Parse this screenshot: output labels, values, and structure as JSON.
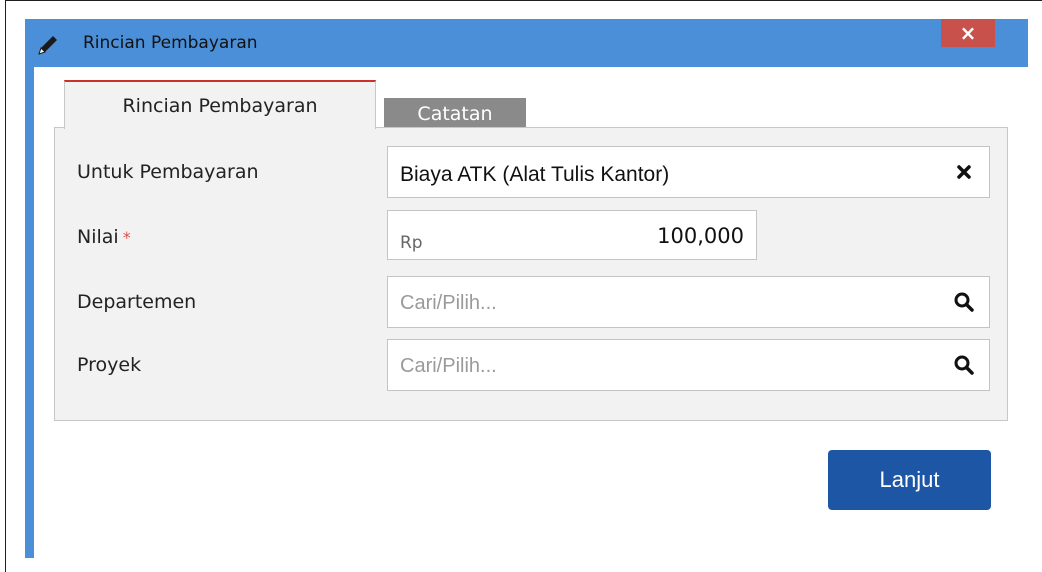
{
  "window": {
    "title": "Rincian Pembayaran",
    "close_glyph": "×",
    "icons": {
      "title": "pencil-icon",
      "close": "close-icon"
    }
  },
  "tabs": [
    {
      "label": "Rincian Pembayaran",
      "active": true
    },
    {
      "label": "Catatan",
      "active": false
    }
  ],
  "form": {
    "untuk_pembayaran": {
      "label": "Untuk Pembayaran",
      "value": "Biaya ATK (Alat Tulis Kantor)",
      "clear_icon": "clear-icon"
    },
    "nilai": {
      "label": "Nilai",
      "required_mark": "*",
      "prefix": "Rp",
      "value": "100,000"
    },
    "departemen": {
      "label": "Departemen",
      "placeholder": "Cari/Pilih...",
      "search_icon": "search-icon"
    },
    "proyek": {
      "label": "Proyek",
      "placeholder": "Cari/Pilih...",
      "search_icon": "search-icon"
    }
  },
  "actions": {
    "next_label": "Lanjut"
  },
  "colors": {
    "titlebar": "#4a8fd8",
    "close_button": "#c9514b",
    "active_tab_accent": "#c8312c",
    "inactive_tab": "#8a8a8a",
    "primary_button": "#1c56a5",
    "required": "#d9534f"
  }
}
